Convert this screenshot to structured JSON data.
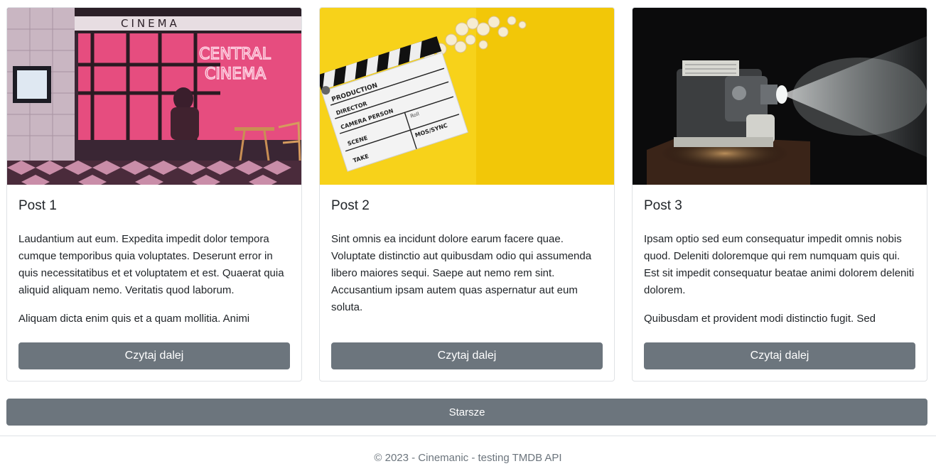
{
  "posts": [
    {
      "title": "Post 1",
      "image": "cinema-storefront-neon",
      "paragraphs": [
        "Laudantium aut eum. Expedita impedit dolor tempora cumque temporibus quia voluptates. Deserunt error in quis necessitatibus et et voluptatem et est. Quaerat quia aliquid aliquam nemo. Veritatis quod laborum.",
        "Aliquam dicta enim quis et a quam mollitia. Animi"
      ],
      "button_label": "Czytaj dalej",
      "image_text": {
        "sign_top": "CINEMA",
        "neon_line1": "CENTRAL",
        "neon_line2": "CINEMA"
      }
    },
    {
      "title": "Post 2",
      "image": "clapperboard-popcorn",
      "paragraphs": [
        "Sint omnis ea incidunt dolore earum facere quae. Voluptate distinctio aut quibusdam odio qui assumenda libero maiores sequi. Saepe aut nemo rem sint. Accusantium ipsam autem quas aspernatur aut eum soluta."
      ],
      "button_label": "Czytaj dalej",
      "image_text": {
        "production": "PRODUCTION",
        "director": "DIRECTOR",
        "camera": "CAMERA PERSON",
        "roll": "Roll",
        "scene": "SCENE",
        "mos": "MOS/SYNC",
        "take": "TAKE"
      }
    },
    {
      "title": "Post 3",
      "image": "film-projector",
      "paragraphs": [
        "Ipsam optio sed eum consequatur impedit omnis nobis quod. Deleniti doloremque qui rem numquam quis qui. Est sit impedit consequatur beatae animi dolorem deleniti dolorem.",
        "Quibusdam et provident modi distinctio fugit. Sed"
      ],
      "button_label": "Czytaj dalej"
    }
  ],
  "pagination": {
    "older_label": "Starsze"
  },
  "footer": {
    "text": "© 2023 - Cinemanic - testing TMDB API"
  },
  "colors": {
    "button": "#6c757d",
    "border": "#dfe2e5",
    "muted_text": "#6c757d"
  }
}
